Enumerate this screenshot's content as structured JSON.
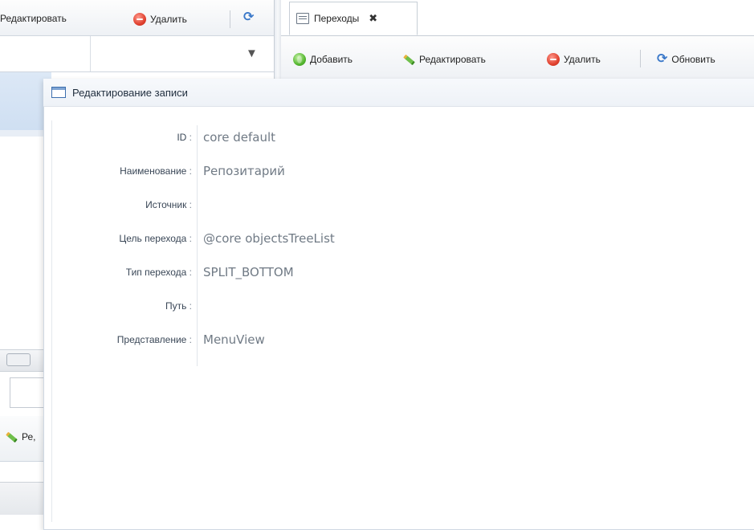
{
  "left_panel": {
    "toolbar": {
      "edit_label": "Редактировать",
      "delete_label": "Удалить"
    },
    "bottom_toolbar": {
      "edit_label_partial": "Ре,"
    }
  },
  "tabs": [
    {
      "label": "Переходы",
      "active": true
    }
  ],
  "right_toolbar": {
    "add_label": "Добавить",
    "edit_label": "Редактировать",
    "delete_label": "Удалить",
    "refresh_label": "Обновить"
  },
  "modal": {
    "title": "Редактирование записи",
    "fields": [
      {
        "label": "ID",
        "value": "core default"
      },
      {
        "label": "Наименование",
        "value": "Репозитарий"
      },
      {
        "label": "Источник",
        "value": ""
      },
      {
        "label": "Цель перехода",
        "value": "@core objectsTreeList"
      },
      {
        "label": "Тип перехода",
        "value": "SPLIT_BOTTOM"
      },
      {
        "label": "Путь",
        "value": ""
      },
      {
        "label": "Представление",
        "value": "MenuView"
      }
    ]
  },
  "colors": {
    "accent": "#3a78c9",
    "delete": "#e0412f",
    "add": "#55b730"
  }
}
